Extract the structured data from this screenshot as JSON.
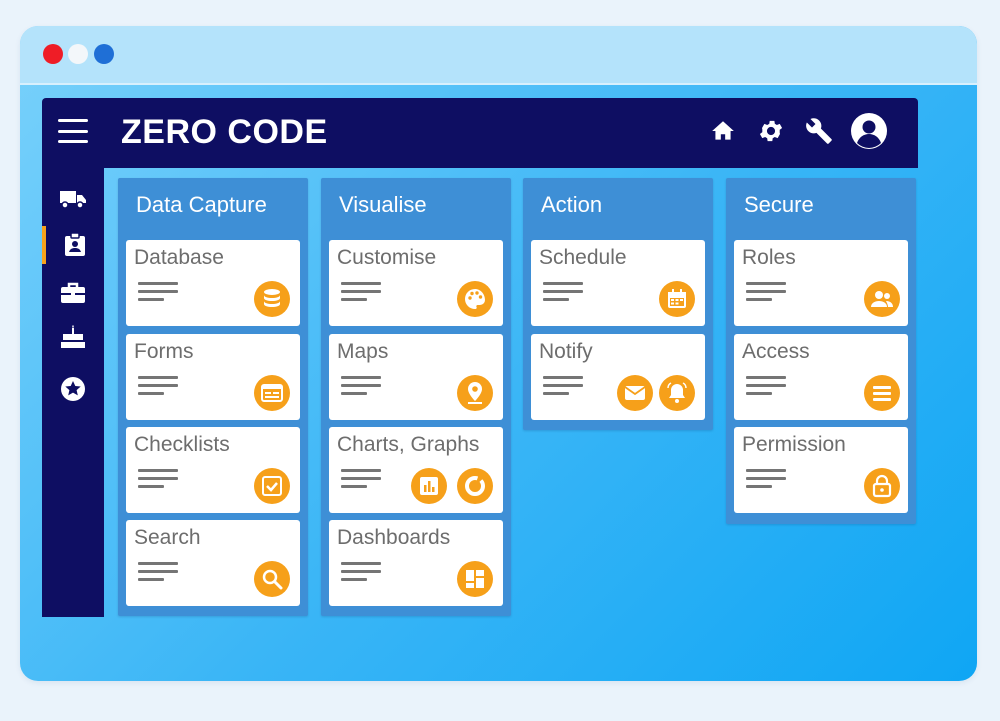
{
  "window": {
    "controls": [
      "close",
      "minimize",
      "maximize"
    ]
  },
  "app": {
    "title": "ZERO CODE",
    "header_icons": [
      "home-icon",
      "gear-icon",
      "wrench-icon",
      "user-avatar-icon"
    ],
    "sidebar_icons": [
      "truck-icon",
      "id-badge-icon",
      "briefcase-icon",
      "cake-icon",
      "star-icon"
    ],
    "active_sidebar_item": 1
  },
  "columns": [
    {
      "title": "Data Capture",
      "cards": [
        {
          "label": "Database",
          "icons": [
            "database-icon"
          ]
        },
        {
          "label": "Forms",
          "icons": [
            "form-icon"
          ]
        },
        {
          "label": "Checklists",
          "icons": [
            "checkbox-icon"
          ]
        },
        {
          "label": "Search",
          "icons": [
            "search-icon"
          ]
        }
      ]
    },
    {
      "title": "Visualise",
      "cards": [
        {
          "label": "Customise",
          "icons": [
            "palette-icon"
          ]
        },
        {
          "label": "Maps",
          "icons": [
            "map-pin-icon"
          ]
        },
        {
          "label": "Charts, Graphs",
          "icons": [
            "bar-chart-icon",
            "donut-chart-icon"
          ]
        },
        {
          "label": "Dashboards",
          "icons": [
            "dashboard-icon"
          ]
        }
      ]
    },
    {
      "title": "Action",
      "cards": [
        {
          "label": "Schedule",
          "icons": [
            "calendar-icon"
          ]
        },
        {
          "label": "Notify",
          "icons": [
            "mail-icon",
            "bell-icon"
          ]
        }
      ]
    },
    {
      "title": "Secure",
      "cards": [
        {
          "label": "Roles",
          "icons": [
            "users-icon"
          ]
        },
        {
          "label": "Access",
          "icons": [
            "list-icon"
          ]
        },
        {
          "label": "Permission",
          "icons": [
            "lock-icon"
          ]
        }
      ]
    }
  ],
  "colors": {
    "navy": "#0e0e62",
    "column": "#3e8fd6",
    "accent": "#f6a01a",
    "card": "#ffffff"
  }
}
